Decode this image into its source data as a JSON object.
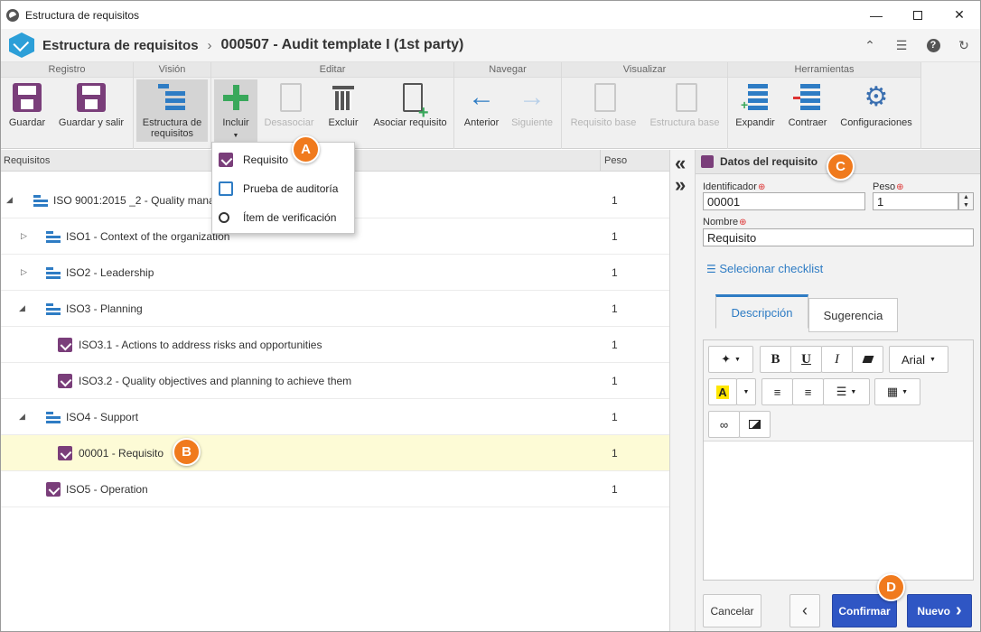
{
  "window": {
    "title": "Estructura de requisitos"
  },
  "header": {
    "crumb_root": "Estructura de requisitos",
    "crumb_sep": "›",
    "crumb_current": "000507 - Audit template I (1st party)"
  },
  "ribbon": {
    "groups": {
      "registro": "Registro",
      "vision": "Visión",
      "editar": "Editar",
      "navegar": "Navegar",
      "visualizar": "Visualizar",
      "herramientas": "Herramientas"
    },
    "buttons": {
      "guardar": "Guardar",
      "guardar_salir": "Guardar y salir",
      "estructura_1": "Estructura de",
      "estructura_2": "requisitos",
      "incluir": "Incluir",
      "desasociar": "Desasociar",
      "excluir": "Excluir",
      "asociar": "Asociar requisito",
      "anterior": "Anterior",
      "siguiente": "Siguiente",
      "req_base": "Requisito base",
      "est_base": "Estructura base",
      "expandir": "Expandir",
      "contraer": "Contraer",
      "configuraciones": "Configuraciones"
    }
  },
  "incluir_menu": {
    "items": [
      "Requisito",
      "Prueba de auditoría",
      "Ítem de verificación"
    ]
  },
  "tree": {
    "col_requisitos": "Requisitos",
    "col_peso": "Peso",
    "rows": [
      {
        "label": "ISO 9001:2015 _2 - Quality mana",
        "weight": "1"
      },
      {
        "label": "ISO1 - Context of the organization",
        "weight": "1"
      },
      {
        "label": "ISO2 - Leadership",
        "weight": "1"
      },
      {
        "label": "ISO3 - Planning",
        "weight": "1"
      },
      {
        "label": "ISO3.1 - Actions to address risks and opportunities",
        "weight": "1"
      },
      {
        "label": "ISO3.2 - Quality objectives and planning to achieve them",
        "weight": "1"
      },
      {
        "label": "ISO4 - Support",
        "weight": "1"
      },
      {
        "label": "00001 - Requisito",
        "weight": "1"
      },
      {
        "label": "ISO5 - Operation",
        "weight": "1"
      }
    ]
  },
  "details": {
    "title": "Datos del requisito",
    "identificador_label": "Identificador",
    "identificador_value": "00001",
    "peso_label": "Peso",
    "peso_value": "1",
    "nombre_label": "Nombre",
    "nombre_value": "Requisito",
    "required_mark": "⊕",
    "checklist_link": "Selecionar checklist",
    "tab_descripcion": "Descripción",
    "tab_sugerencia": "Sugerencia",
    "font_select": "Arial",
    "btn_cancelar": "Cancelar",
    "btn_confirmar": "Confirmar",
    "btn_nuevo": "Nuevo"
  },
  "markers": {
    "a": "A",
    "b": "B",
    "c": "C",
    "d": "D"
  },
  "colors": {
    "accent_blue": "#2f56c4",
    "marker_orange": "#f07a1d",
    "selected_row": "#fdfbd6",
    "requisito_purple": "#7a3e7a"
  }
}
